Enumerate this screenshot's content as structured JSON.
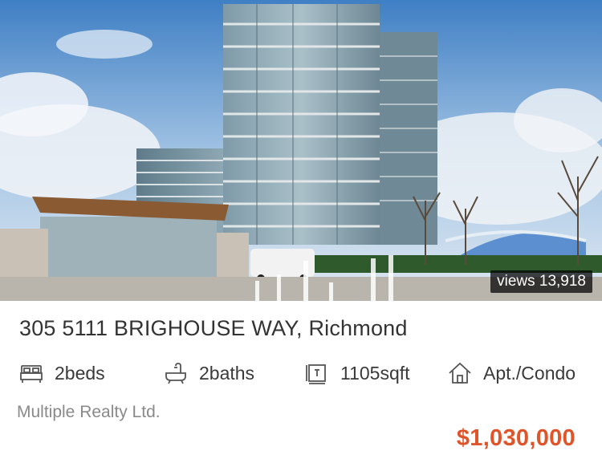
{
  "listing": {
    "photo_alt": "Listing photo",
    "views": "views 13,918",
    "address": "305 5111 BRIGHOUSE WAY, Richmond",
    "features": [
      {
        "icon": "bed-icon",
        "label": "2beds"
      },
      {
        "icon": "bathtub-icon",
        "label": "2baths"
      },
      {
        "icon": "floor-area-icon",
        "label": "1105sqft"
      },
      {
        "icon": "house-icon",
        "label": "Apt./Condo"
      }
    ],
    "realty": "Multiple Realty Ltd.",
    "price": "$1,030,000",
    "price_color": "#e0542a"
  }
}
